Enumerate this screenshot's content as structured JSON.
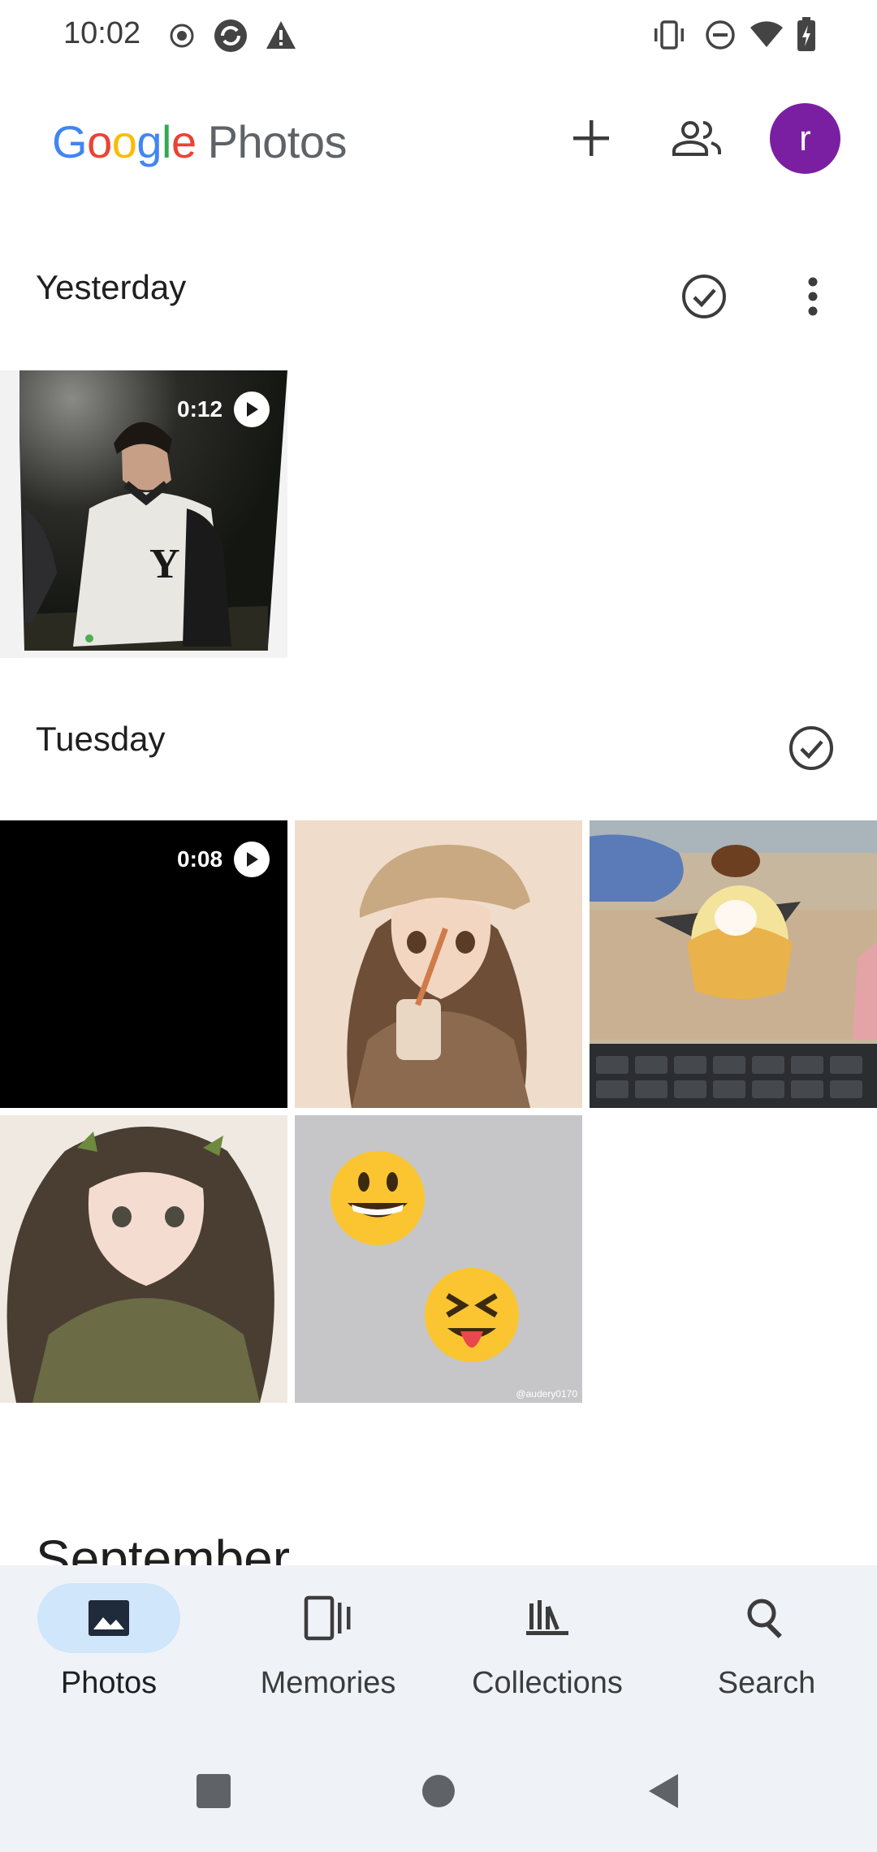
{
  "status_bar": {
    "time": "10:02"
  },
  "app_bar": {
    "logo_google": [
      "G",
      "o",
      "o",
      "g",
      "l",
      "e"
    ],
    "logo_photos": "Photos",
    "avatar_letter": "r"
  },
  "sections": [
    {
      "title": "Yesterday",
      "items": [
        {
          "type": "video",
          "duration": "0:12"
        }
      ]
    },
    {
      "title": "Tuesday",
      "items": [
        {
          "type": "video",
          "duration": "0:08"
        },
        {
          "type": "photo"
        },
        {
          "type": "photo"
        },
        {
          "type": "photo"
        },
        {
          "type": "photo"
        }
      ]
    },
    {
      "title": "September"
    }
  ],
  "watermark": "@audery0170",
  "bottom_nav": [
    {
      "label": "Photos",
      "icon": "photo-icon",
      "active": true
    },
    {
      "label": "Memories",
      "icon": "memories-icon",
      "active": false
    },
    {
      "label": "Collections",
      "icon": "collections-icon",
      "active": false
    },
    {
      "label": "Search",
      "icon": "search-icon",
      "active": false
    }
  ],
  "colors": {
    "avatar": "#7b1fa2",
    "nav_background": "#eff3f8",
    "active_pill": "#cfe6fb"
  }
}
